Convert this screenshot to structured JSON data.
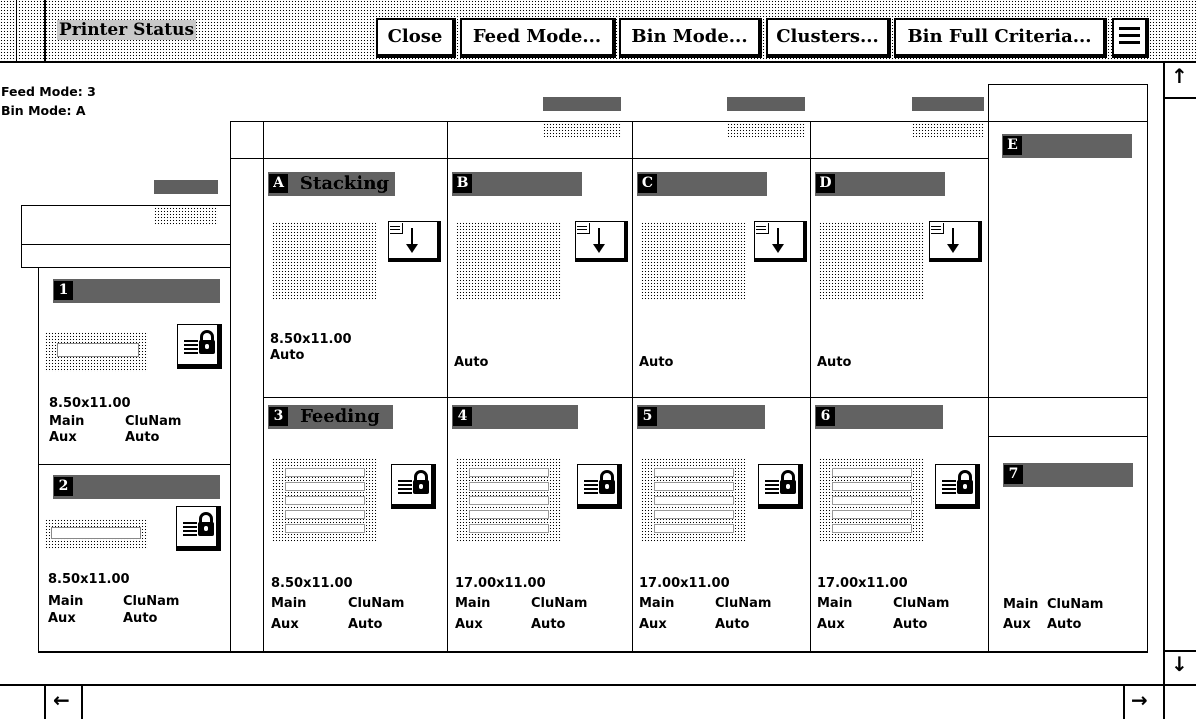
{
  "window": {
    "title": "Printer Status",
    "close": "Close",
    "feed_mode": "Feed Mode...",
    "bin_mode": "Bin Mode...",
    "clusters": "Clusters...",
    "bin_full": "Bin Full Criteria..."
  },
  "status": {
    "feed_mode": "Feed Mode: 3",
    "bin_mode": "Bin Mode: A"
  },
  "bins": [
    {
      "id": "A",
      "label": "Stacking",
      "size": "8.50x11.00",
      "mode": "Auto"
    },
    {
      "id": "B",
      "label": "",
      "size": "",
      "mode": "Auto"
    },
    {
      "id": "C",
      "label": "",
      "size": "",
      "mode": "Auto"
    },
    {
      "id": "D",
      "label": "",
      "size": "",
      "mode": "Auto"
    },
    {
      "id": "E",
      "label": "",
      "size": "",
      "mode": ""
    }
  ],
  "trays": [
    {
      "id": "1",
      "label": "",
      "size": "8.50x11.00",
      "r1a": "Main",
      "r1b": "CluNam",
      "r2a": "Aux",
      "r2b": "Auto"
    },
    {
      "id": "2",
      "label": "",
      "size": "8.50x11.00",
      "r1a": "Main",
      "r1b": "CluNam",
      "r2a": "Aux",
      "r2b": "Auto"
    },
    {
      "id": "3",
      "label": "Feeding",
      "size": "8.50x11.00",
      "r1a": "Main",
      "r1b": "CluNam",
      "r2a": "Aux",
      "r2b": "Auto"
    },
    {
      "id": "4",
      "label": "",
      "size": "17.00x11.00",
      "r1a": "Main",
      "r1b": "CluNam",
      "r2a": "Aux",
      "r2b": "Auto"
    },
    {
      "id": "5",
      "label": "",
      "size": "17.00x11.00",
      "r1a": "Main",
      "r1b": "CluNam",
      "r2a": "Aux",
      "r2b": "Auto"
    },
    {
      "id": "6",
      "label": "",
      "size": "17.00x11.00",
      "r1a": "Main",
      "r1b": "CluNam",
      "r2a": "Aux",
      "r2b": "Auto"
    },
    {
      "id": "7",
      "label": "",
      "size": "",
      "r1a": "Main",
      "r1b": "CluNam",
      "r2a": "Aux",
      "r2b": "Auto"
    }
  ],
  "scroll": {
    "up": "↑",
    "down": "↓",
    "left": "←",
    "right": "→"
  }
}
